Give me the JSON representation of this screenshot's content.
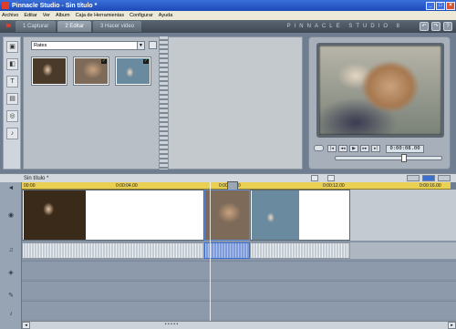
{
  "window": {
    "title": "Pinnacle Studio - Sin título *"
  },
  "menu": [
    "Archivo",
    "Editar",
    "Ver",
    "Album",
    "Caja de Herramientas",
    "Configurar",
    "Ayuda"
  ],
  "tabs": [
    {
      "label": "1 Capturar"
    },
    {
      "label": "2 Editar"
    },
    {
      "label": "3 Hacer video"
    }
  ],
  "brand": "PINNACLE STUDIO 8",
  "album": {
    "selected": "Rates"
  },
  "player": {
    "timecode": "0:00:08.00"
  },
  "timeline": {
    "project_title": "Sin título *",
    "ticks": [
      "00:00",
      "0:00:04.00",
      "0:00:08.00",
      "0:00:12.00",
      "0:00:16.00"
    ]
  },
  "icons": {
    "flag": "pinnacle-flag-icon",
    "camera": "camera-icon",
    "help": "help-icon",
    "trash": "trash-icon"
  },
  "colors": {
    "accent": "#3b6fd0",
    "ruler": "#e9cf52"
  }
}
